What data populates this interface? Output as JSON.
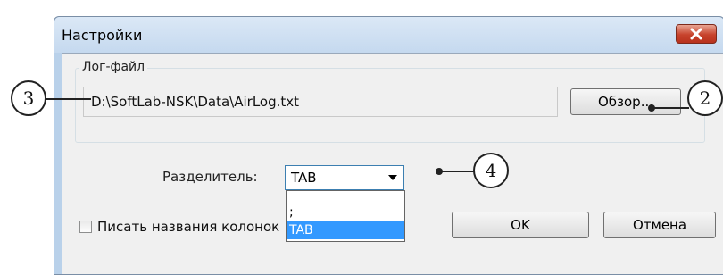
{
  "dialog": {
    "title": "Настройки",
    "log_group_label": "Лог-файл",
    "log_path": "D:\\SoftLab-NSK\\Data\\AirLog.txt",
    "browse_label": "Обзор...",
    "separator_label": "Разделитель:",
    "separator_value": "TAB",
    "separator_options": [
      ";",
      "TAB"
    ],
    "write_columns_label": "Писать названия колонок",
    "write_columns_checked": false,
    "ok_label": "OK",
    "cancel_label": "Отмена"
  },
  "callouts": {
    "path_field": "3",
    "browse_button": "2",
    "separator_combo": "4"
  },
  "colors": {
    "frame": "#b9d1ea",
    "selection": "#3399ff",
    "close_button": "#c7432c"
  }
}
